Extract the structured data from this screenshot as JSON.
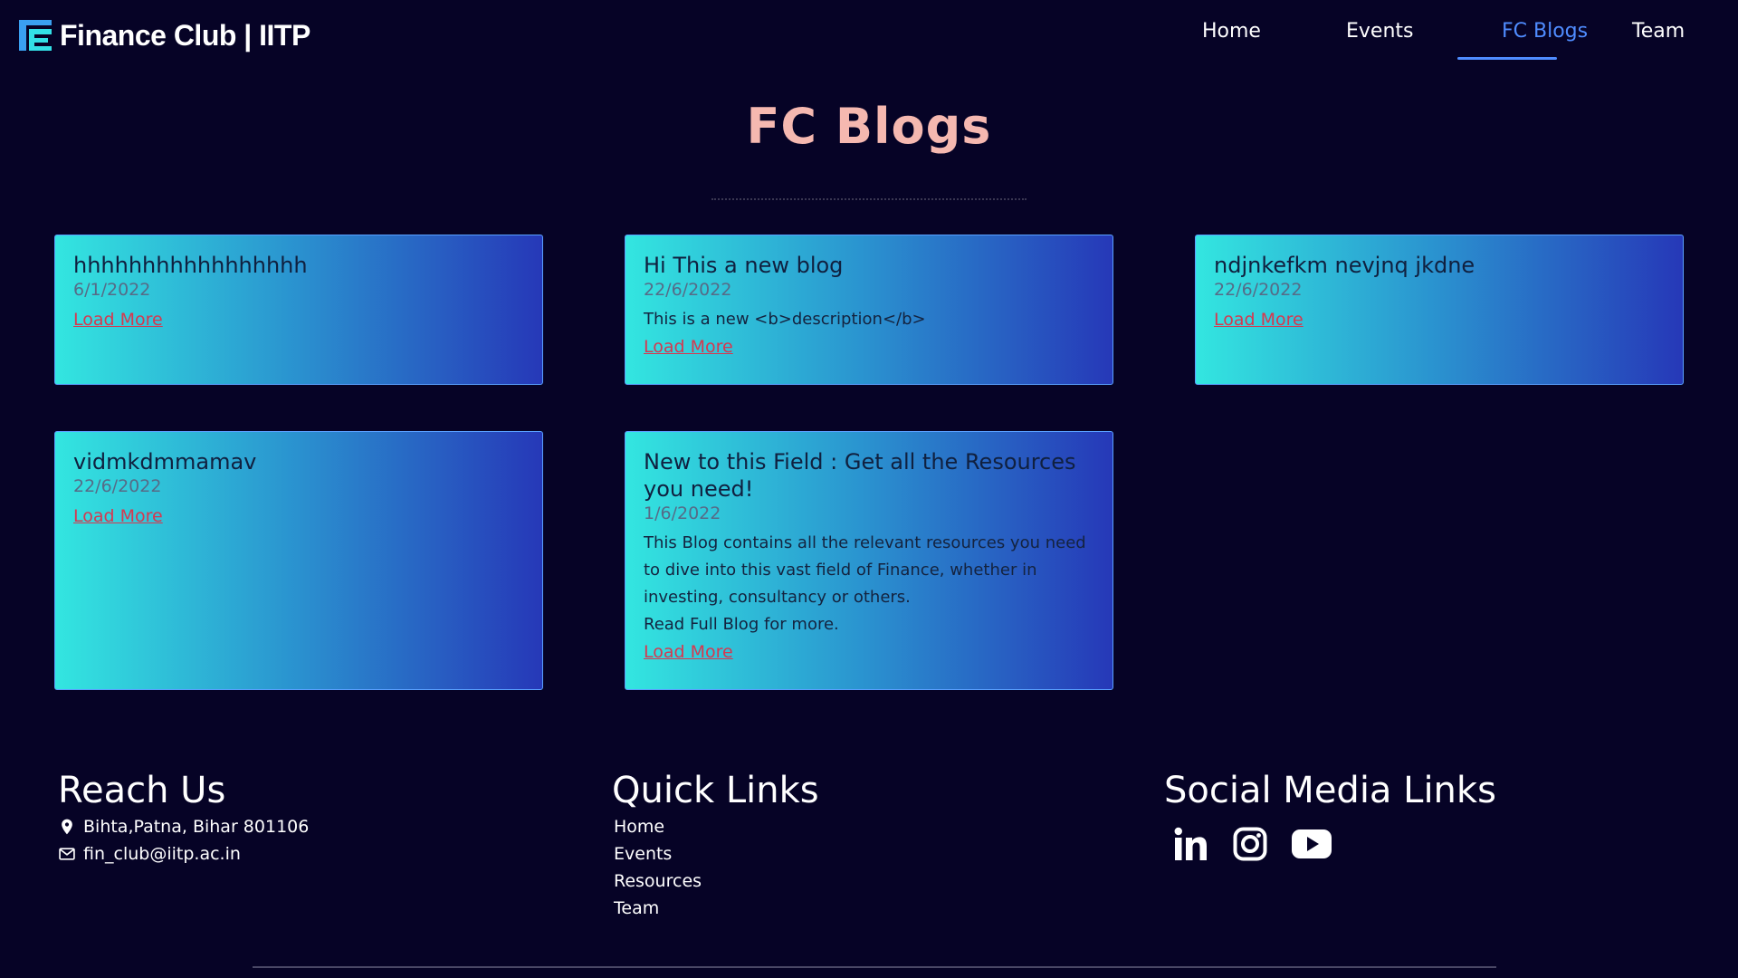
{
  "navbar": {
    "brand": "Finance Club | IITP",
    "links": [
      {
        "label": "Home",
        "active": false
      },
      {
        "label": "Events",
        "active": false
      },
      {
        "label": "FC Blogs",
        "active": true
      },
      {
        "label": "Team",
        "active": false
      }
    ],
    "active_color": "#4f8cff"
  },
  "page": {
    "title": "FC Blogs"
  },
  "blogs": [
    {
      "title": "hhhhhhhhhhhhhhhhh",
      "date": "6/1/2022",
      "description": "",
      "more": "Load More"
    },
    {
      "title": "Hi This a new blog",
      "date": "22/6/2022",
      "description": "This is a new <b>description</b>",
      "more": "Load More"
    },
    {
      "title": "ndjnkefkm nevjnq jkdne",
      "date": "22/6/2022",
      "description": "",
      "more": "Load More"
    },
    {
      "title": "vidmkdmmamav",
      "date": "22/6/2022",
      "description": "",
      "more": "Load More"
    },
    {
      "title": "New to this Field : Get all the Resources you need!",
      "date": "1/6/2022",
      "description": "This Blog contains all the relevant resources you need to dive into this vast field of Finance, whether in investing, consultancy or others.",
      "description_2": "Read Full Blog for more.",
      "more": "Load More"
    }
  ],
  "footer": {
    "reach_us": {
      "heading": "Reach Us",
      "address": "Bihta,Patna, Bihar 801106",
      "email": "fin_club@iitp.ac.in",
      "icons": [
        "location-pin-icon",
        "mail-icon"
      ]
    },
    "quick_links": {
      "heading": "Quick Links",
      "items": [
        "Home",
        "Events",
        "Resources",
        "Team"
      ]
    },
    "social": {
      "heading": "Social Media Links",
      "icons": [
        "linkedin-icon",
        "instagram-icon",
        "youtube-icon"
      ]
    }
  },
  "colors": {
    "background": "#060326",
    "title": "#f5b8b0",
    "card_gradient_start": "#33e6e0",
    "card_gradient_end": "#2638b8",
    "load_more": "#d6384f"
  }
}
